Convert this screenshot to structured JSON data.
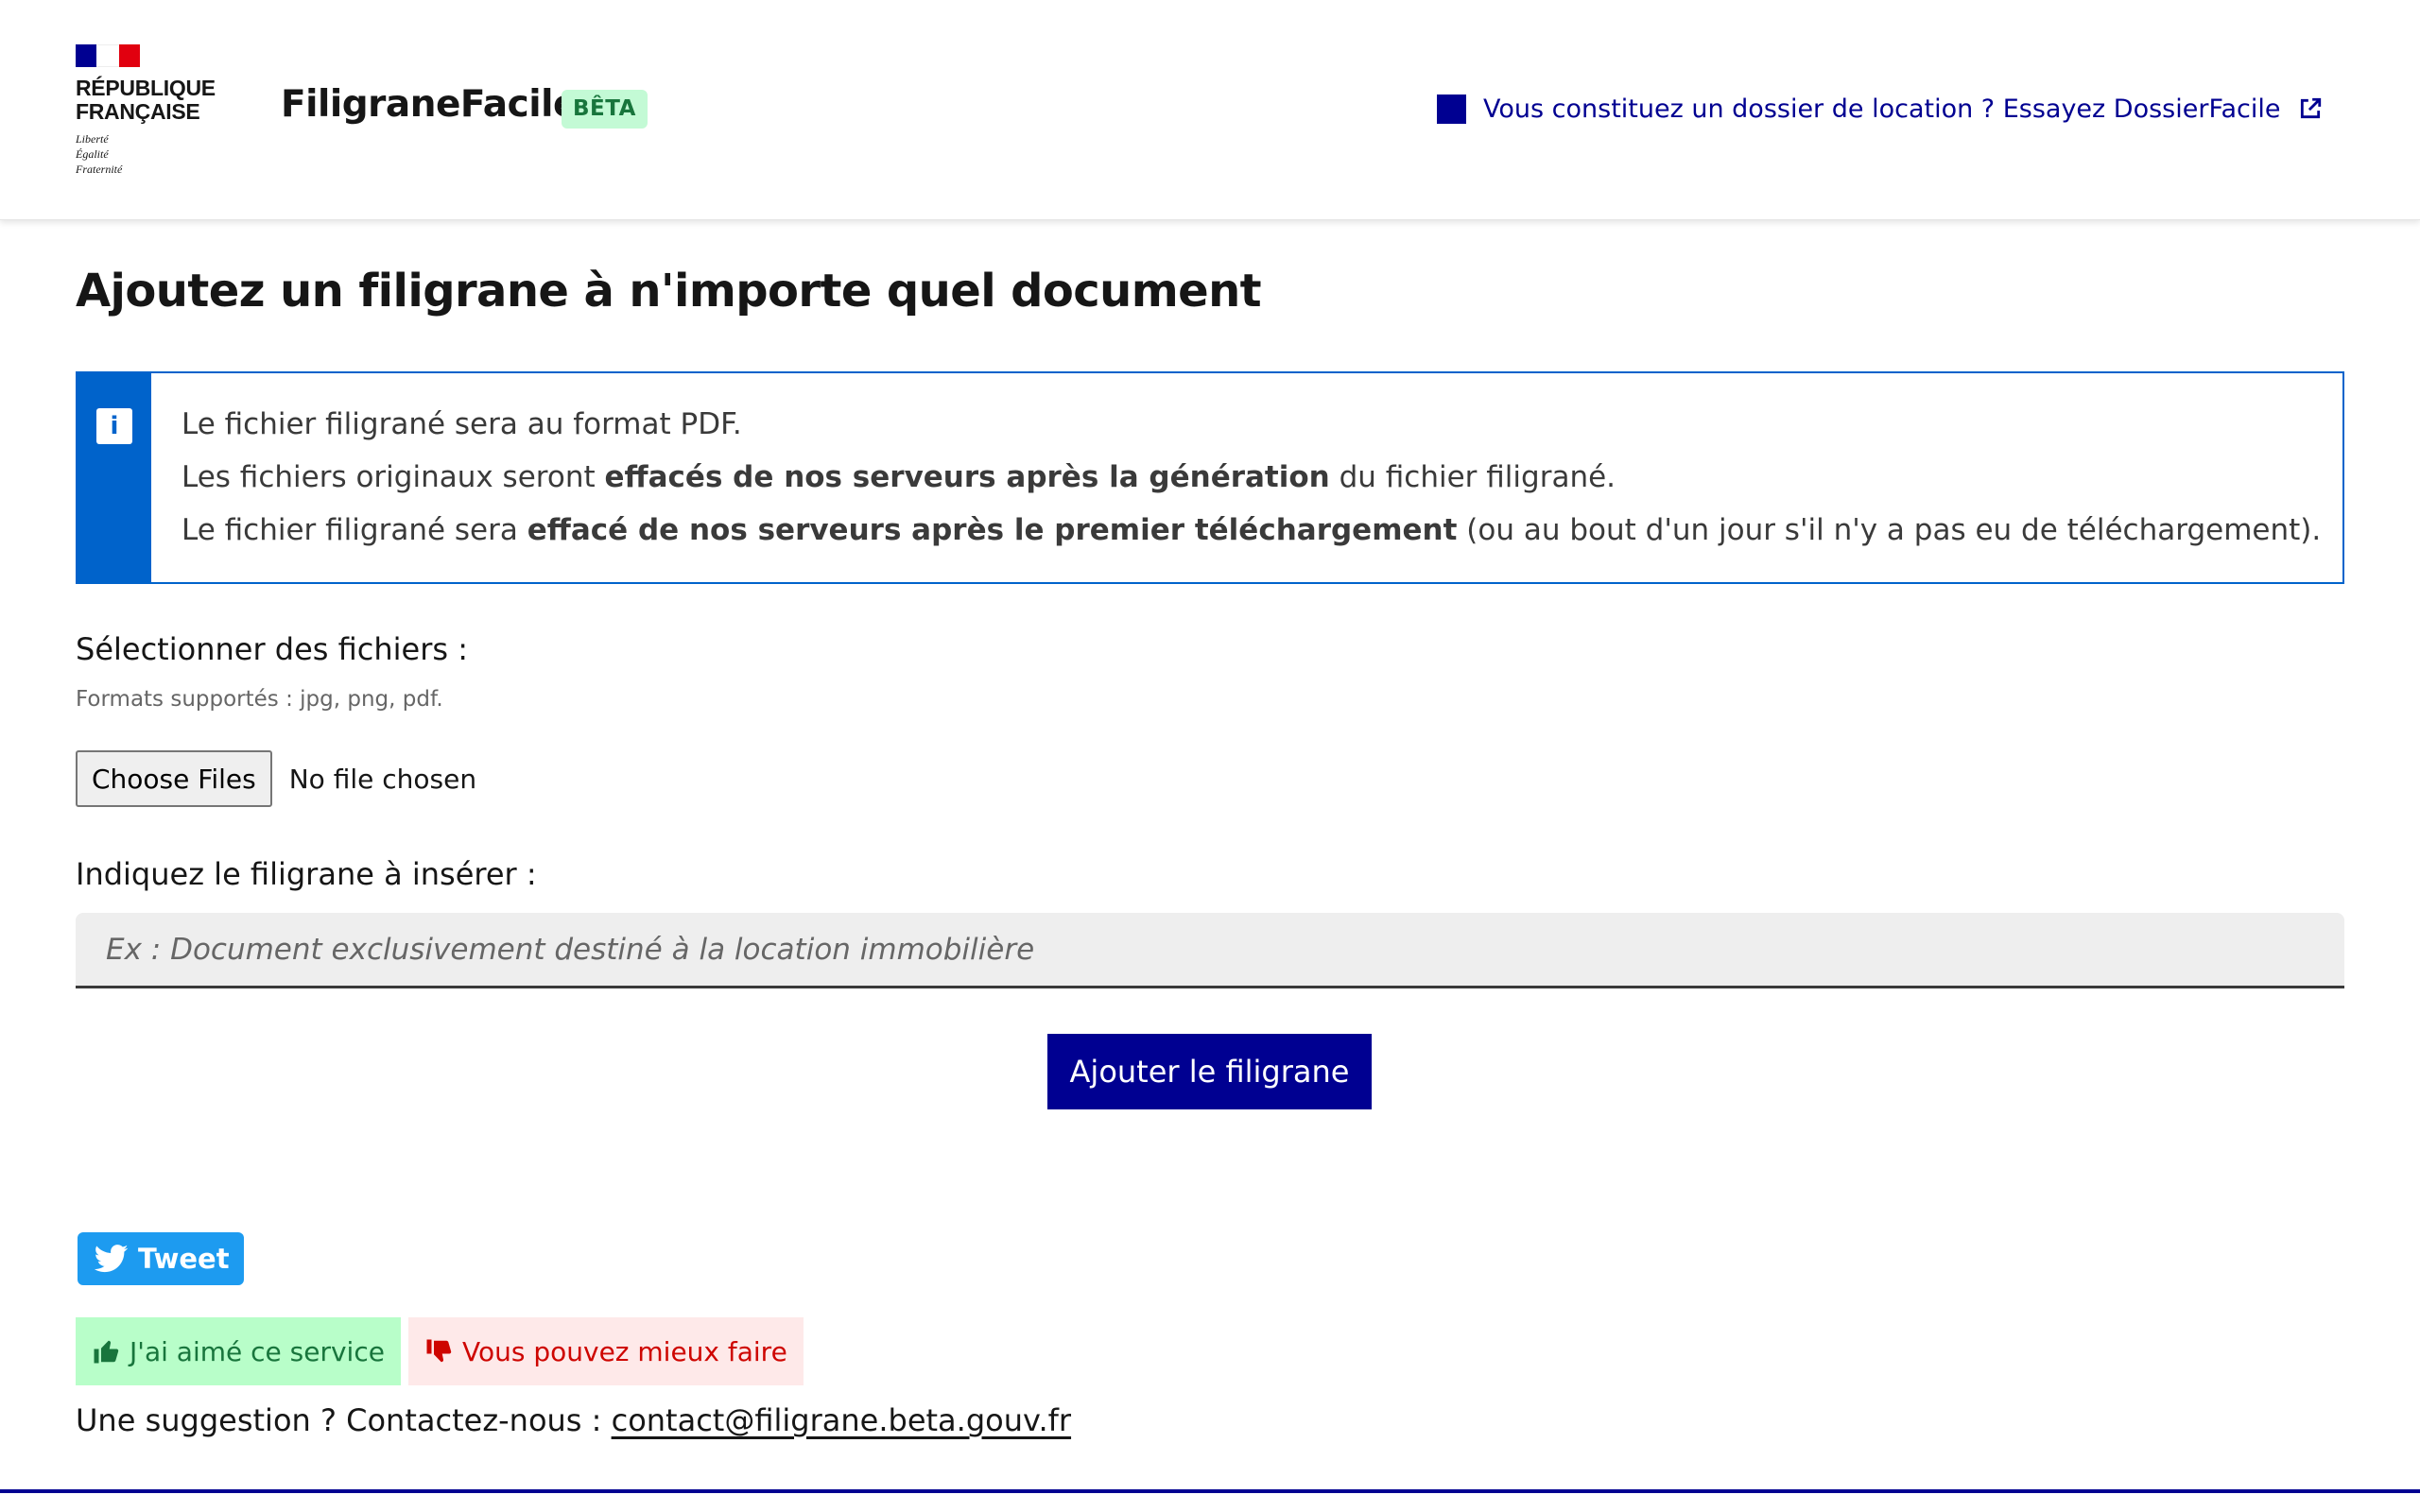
{
  "colors": {
    "primary": "#000091",
    "info": "#0063cb",
    "success_bg": "#b8fec9",
    "success_text": "#18753c",
    "error_bg": "#fee9e9",
    "error_text": "#ce0500",
    "beta_bg": "#c3fad5",
    "twitter": "#1d9bf0"
  },
  "header": {
    "rf_name": "RÉPUBLIQUE\nFRANÇAISE",
    "rf_motto": "Liberté\nÉgalité\nFraternité",
    "service_title": "FiligraneFacile",
    "beta_badge": "BÊTA",
    "dossier_link": "Vous constituez un dossier de location ? Essayez DossierFacile"
  },
  "main": {
    "page_title": "Ajoutez un filigrane à n'importe quel document",
    "info": {
      "line1": "Le fichier filigrané sera au format PDF.",
      "line2_pre": "Les fichiers originaux seront ",
      "line2_bold": "effacés de nos serveurs après la génération",
      "line2_post": " du fichier filigrané.",
      "line3_pre": "Le fichier filigrané sera ",
      "line3_bold": "effacé de nos serveurs après le premier téléchargement",
      "line3_post": " (ou au bout d'un jour s'il n'y a pas eu de téléchargement)."
    },
    "files_label": "Sélectionner des fichiers :",
    "files_hint": "Formats supportés : jpg, png, pdf.",
    "choose_files": "Choose Files",
    "no_file": "No file chosen",
    "watermark_label": "Indiquez le filigrane à insérer :",
    "watermark_placeholder": "Ex : Document exclusivement destiné à la location immobilière",
    "watermark_value": "",
    "submit": "Ajouter le filigrane"
  },
  "feedback": {
    "tweet": "Tweet",
    "like": "J'ai aimé ce service",
    "dislike": "Vous pouvez mieux faire",
    "suggestion_prefix": "Une suggestion ? Contactez-nous : ",
    "contact_email": "contact@filigrane.beta.gouv.fr"
  }
}
